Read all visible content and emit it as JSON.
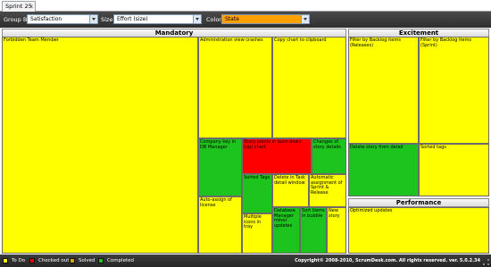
{
  "tab": {
    "label": "Sprint 25",
    "close": "x"
  },
  "toolbar": {
    "group_by_label": "Group By",
    "group_by_value": "Satisfaction",
    "size_label": "Size",
    "size_value": "Effort (size)",
    "color_label": "Color",
    "color_value": "State"
  },
  "groups": {
    "mandatory": "Mandatory",
    "excitement": "Excitement",
    "performance": "Performance"
  },
  "items": {
    "forbidden": "Forbidden Team Member",
    "admin_crashes": "Administration view crashes",
    "copy_chart": "Copy chart to clipboard",
    "company_key": "Company key in DB Manager",
    "story_points": "Story points in burn-down (up) chart",
    "changes_details": "Changes of story details",
    "sorted_tags_1": "Sorted Tags",
    "delete_task": "Delete in Task detail window",
    "auto_assign_sprint": "Automatic assignment of Sprint & Release",
    "auto_assign_license": "Auto-assign of license",
    "multiple_icons": "Multiple icons in tray",
    "db_manager": "Database Manager minor updates",
    "sort_items": "Sort items in bubble",
    "new_story": "New story",
    "filter_releases": "Filter by Backlog items (Releases)",
    "filter_sprint": "Filter by Backlog items (Sprint)",
    "delete_story": "Delete story from detail",
    "sorted_tags_2": "Sorted tags",
    "optimized": "Optimized updates"
  },
  "legend": {
    "todo": "To Do",
    "checked_out": "Checked out",
    "solved": "Solved",
    "completed": "Completed"
  },
  "colors": {
    "todo": "#ffff00",
    "checked_out": "#ff0000",
    "solved": "#d4a020",
    "completed": "#1ec41e"
  },
  "copyright": "Copyright© 2008-2010, ScrumDesk.com. All rights reserved. ver. 5.0.2.34"
}
